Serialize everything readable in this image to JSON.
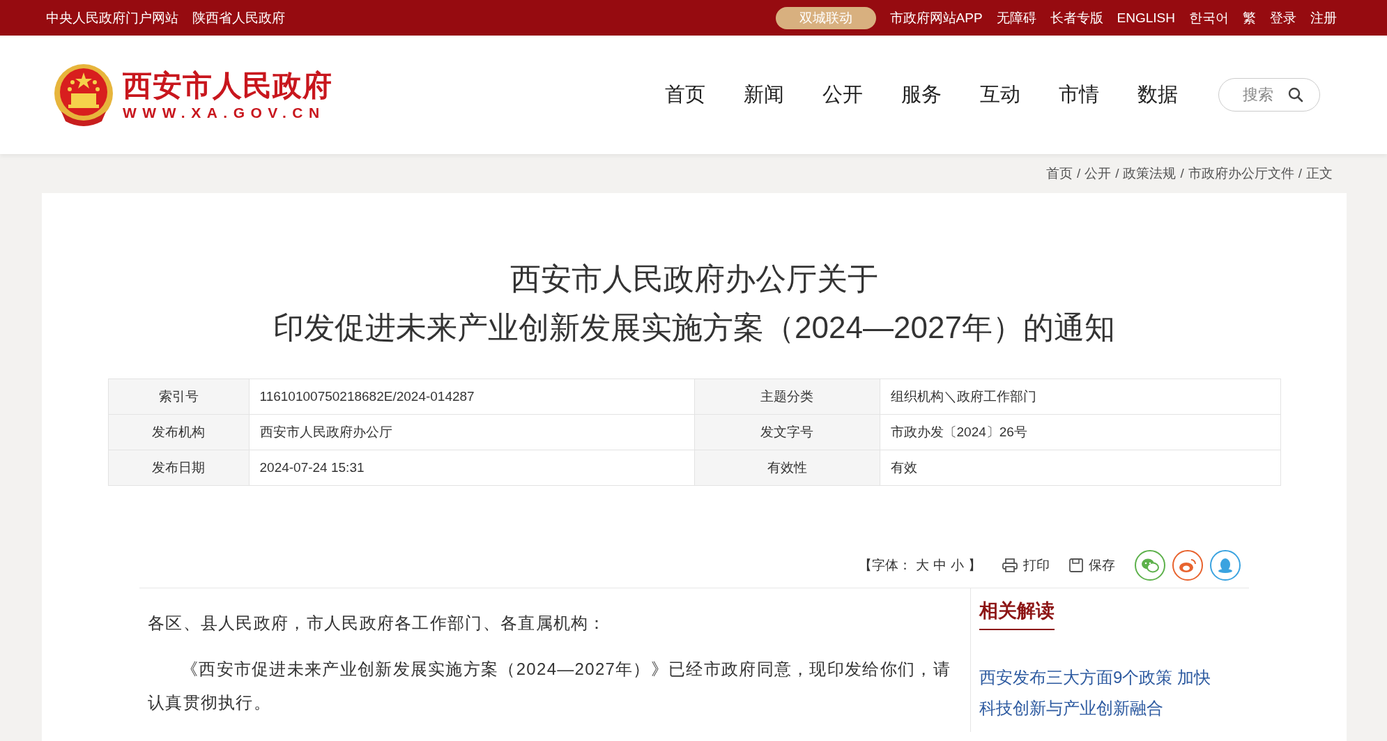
{
  "top_bar": {
    "left_links": [
      "中央人民政府门户网站",
      "陕西省人民政府"
    ],
    "highlight_button": "双城联动",
    "right_links": [
      "市政府网站APP",
      "无障碍",
      "长者专版",
      "ENGLISH",
      "한국어",
      "繁",
      "登录",
      "注册"
    ]
  },
  "header": {
    "site_name": "西安市人民政府",
    "site_url": "WWW.XA.GOV.CN",
    "nav": [
      {
        "label": "首页"
      },
      {
        "label": "新闻"
      },
      {
        "label": "公开"
      },
      {
        "label": "服务"
      },
      {
        "label": "互动"
      },
      {
        "label": "市情"
      },
      {
        "label": "数据"
      }
    ],
    "search": {
      "placeholder": "搜索"
    }
  },
  "breadcrumb": {
    "separator": "/",
    "items": [
      "首页",
      "公开",
      "政策法规",
      "市政府办公厅文件",
      "正文"
    ]
  },
  "article": {
    "title_lines": [
      "西安市人民政府办公厅关于",
      "印发促进未来产业创新发展实施方案（2024—2027年）的通知"
    ],
    "meta": [
      {
        "label": "索引号",
        "value": "11610100750218682E/2024-014287"
      },
      {
        "label": "主题分类",
        "value": "组织机构＼政府工作部门"
      },
      {
        "label": "发布机构",
        "value": "西安市人民政府办公厅"
      },
      {
        "label": "发文字号",
        "value": "市政办发〔2024〕26号"
      },
      {
        "label": "发布日期",
        "value": "2024-07-24 15:31"
      },
      {
        "label": "有效性",
        "value": "有效"
      }
    ],
    "tools": {
      "font_label": "【字体：",
      "font_options": [
        "大",
        "中",
        "小"
      ],
      "font_end": "】",
      "print": "打印",
      "save": "保存"
    },
    "paragraphs": [
      {
        "text": "各区、县人民政府，市人民政府各工作部门、各直属机构：",
        "indent": false
      },
      {
        "text": "《西安市促进未来产业创新发展实施方案（2024—2027年）》已经市政府同意，现印发给你们，请认真贯彻执行。",
        "indent": true
      }
    ]
  },
  "related": {
    "title": "相关解读",
    "links": [
      "西安发布三大方面9个政策 加快科技创新与产业创新融合"
    ]
  }
}
